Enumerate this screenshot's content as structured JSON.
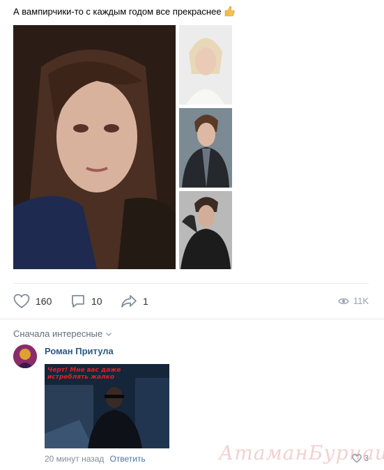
{
  "post": {
    "text": "А вампирчики-то с каждым годом все прекраснее"
  },
  "actions": {
    "likes": "160",
    "comments": "10",
    "shares": "1",
    "views": "11K"
  },
  "comments_section": {
    "sort_label": "Сначала интересные"
  },
  "comment": {
    "author": "Роман Притула",
    "meme_text": "Черт! Мне вас даже истреблять жалко",
    "time": "20 минут назад",
    "reply_label": "Ответить",
    "likes": "3"
  },
  "watermark": "АтаманБурнаш для ЯП",
  "colors": {
    "link": "#2a5885",
    "meta": "#818c99",
    "divider": "#e7e8ec"
  }
}
